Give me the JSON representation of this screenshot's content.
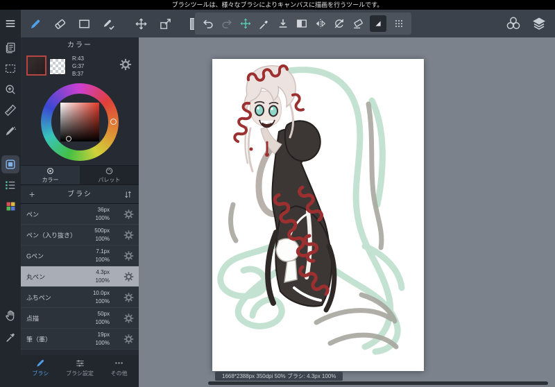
{
  "top_bar": {
    "message": "ブラシツールは、様々なブラシによりキャンバスに描画を行うツールです。"
  },
  "toolbar": {
    "tools": [
      "brush-icon",
      "eraser-icon",
      "rect-select-icon",
      "brush-check-icon",
      "move-icon",
      "transform-icon",
      "color-swatch"
    ],
    "floating": [
      "undo-icon",
      "redo-icon",
      "smart-move-icon",
      "eyedropper-icon",
      "download-icon",
      "selection-icon",
      "flip-horizontal-icon",
      "rotate-disabled-icon",
      "clear-icon",
      "panel-tile-icon",
      "drag-handle-icon"
    ],
    "right": [
      "color-set-icon",
      "layers-icon"
    ]
  },
  "left_strip": {
    "icons": [
      "menu-icon",
      "pages-icon",
      "marquee-icon",
      "zoom-icon",
      "ruler-icon",
      "pen-icon",
      "panel-toggle-icon",
      "layer-list-icon",
      "color-grid-icon",
      "hand-icon",
      "eyedropper-icon"
    ]
  },
  "color_panel": {
    "title": "カラー",
    "rgb": [
      "R:43",
      "G:37",
      "B:37"
    ],
    "tabs": [
      {
        "label": "カラー",
        "selected": true
      },
      {
        "label": "パレット",
        "selected": false
      }
    ]
  },
  "brush_panel": {
    "add_label": "+",
    "title": "ブラシ",
    "brushes": [
      {
        "name": "ペン",
        "size": "36px",
        "opacity": "100%",
        "selected": false
      },
      {
        "name": "ペン（入り抜き）",
        "size": "500px",
        "opacity": "100%",
        "selected": false
      },
      {
        "name": "Gペン",
        "size": "7.1px",
        "opacity": "100%",
        "selected": false
      },
      {
        "name": "丸ペン",
        "size": "4.3px",
        "opacity": "100%",
        "selected": true
      },
      {
        "name": "ふちペン",
        "size": "10.0px",
        "opacity": "100%",
        "selected": false
      },
      {
        "name": "点描",
        "size": "50px",
        "opacity": "100%",
        "selected": false
      },
      {
        "name": "筆（墨）",
        "size": "19px",
        "opacity": "100%",
        "selected": false
      }
    ],
    "footer_tabs": [
      {
        "label": "ブラシ",
        "active": true
      },
      {
        "label": "ブラシ設定",
        "active": false
      },
      {
        "label": "その他",
        "active": false
      }
    ]
  },
  "canvas": {
    "status": "1668*2388px 350dpi 50%  ブラシ: 4.3px 100%"
  },
  "colors": {
    "accent_blue": "#4f9fe8",
    "teal_tool": "#5bc8b2",
    "selected_color_rgb": "rgb(43,37,37)",
    "brush_red": "#9c3030",
    "mint_paint": "#c3e2d2",
    "workspace_gray": "#7b828c"
  }
}
